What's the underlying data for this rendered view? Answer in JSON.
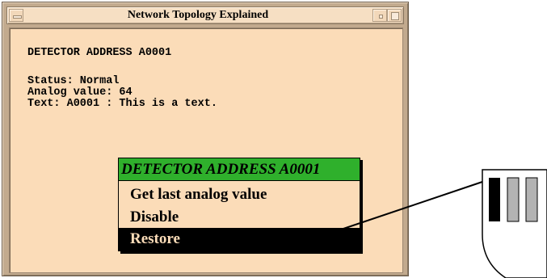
{
  "window": {
    "title": "Network Topology Explained"
  },
  "detector_info": {
    "heading": "DETECTOR ADDRESS A0001",
    "status": "Status: Normal",
    "analog_value": "Analog value: 64",
    "text": "Text: A0001 : This is a text."
  },
  "popup_menu": {
    "title": "DETECTOR ADDRESS A0001",
    "items": [
      {
        "label": "Get last analog value"
      },
      {
        "label": "Disable"
      },
      {
        "label": "Restore",
        "selected": true
      }
    ]
  },
  "colors": {
    "window_background": "#fbdcb8",
    "window_frame": "#c2aa8e",
    "popup_title_green": "#2fb02c",
    "selected_item": "#000000"
  }
}
